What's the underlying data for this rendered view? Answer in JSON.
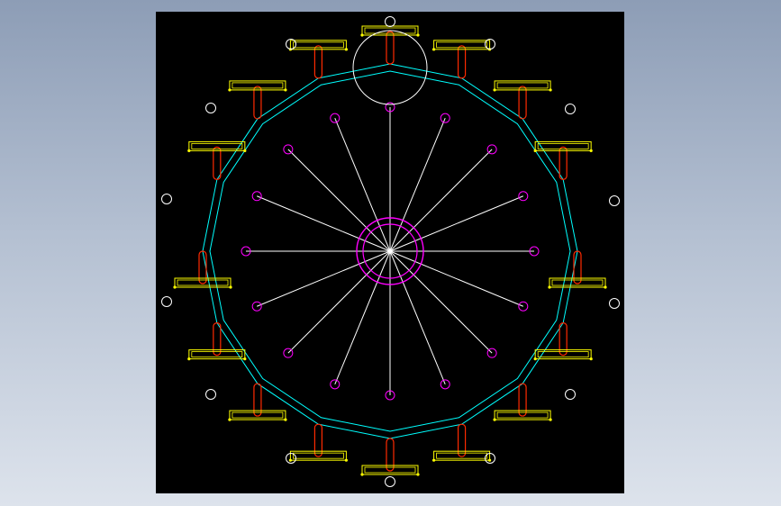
{
  "viewport": {
    "background": "#000000",
    "page_background": "#a0aec2"
  },
  "drawing": {
    "type": "cad-wheel-mechanism",
    "spoke_count": 16,
    "arm_count": 16,
    "colors": {
      "spokes": "#ffffff",
      "mounting_holes": "#ffffff",
      "rim": "#00ffff",
      "hub": "#ff00ff",
      "spoke_ends": "#ff00ff",
      "slots": "#ff2a00",
      "brackets": "#ffff00",
      "top_circle": "#ffffff"
    },
    "mounting_hole_count": 14
  }
}
